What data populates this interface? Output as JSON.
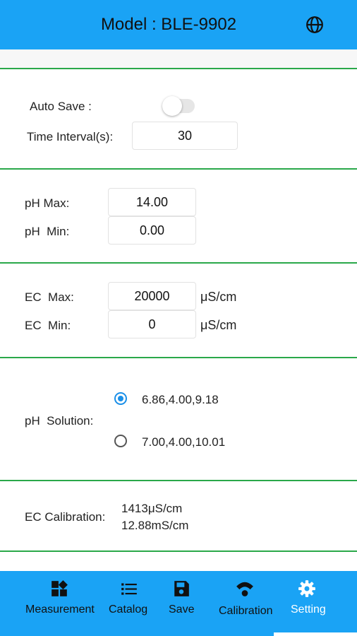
{
  "header": {
    "title": "Model : BLE-9902",
    "language_icon": "globe-icon"
  },
  "autosave": {
    "auto_save_label": "Auto Save :",
    "auto_save_on": false,
    "interval_label": "Time Interval(s):",
    "interval_value": "30"
  },
  "ph": {
    "max_label": "pH Max:",
    "max_value": "14.00",
    "min_label": "pH  Min:",
    "min_value": "0.00"
  },
  "ec": {
    "max_label": "EC  Max:",
    "max_value": "20000",
    "min_label": "EC  Min:",
    "min_value": "0",
    "unit": "μS/cm"
  },
  "solution": {
    "label": "pH  Solution:",
    "options": [
      {
        "text": "6.86,4.00,9.18",
        "selected": true
      },
      {
        "text": "7.00,4.00,10.01",
        "selected": false
      }
    ]
  },
  "ec_calibration": {
    "label": "EC Calibration:",
    "line1": "1413μS/cm",
    "line2": "12.88mS/cm"
  },
  "nav": {
    "items": [
      {
        "label": "Measurement",
        "icon": "dashboard-icon"
      },
      {
        "label": "Catalog",
        "icon": "list-icon"
      },
      {
        "label": "Save",
        "icon": "floppy-disk-icon"
      },
      {
        "label": "Calibration",
        "icon": "signal-icon"
      },
      {
        "label": "Setting",
        "icon": "gear-icon"
      }
    ],
    "active": "Setting"
  },
  "colors": {
    "primary": "#1aa3f5",
    "divider": "#2aa84a",
    "radio": "#1a8fe8"
  }
}
